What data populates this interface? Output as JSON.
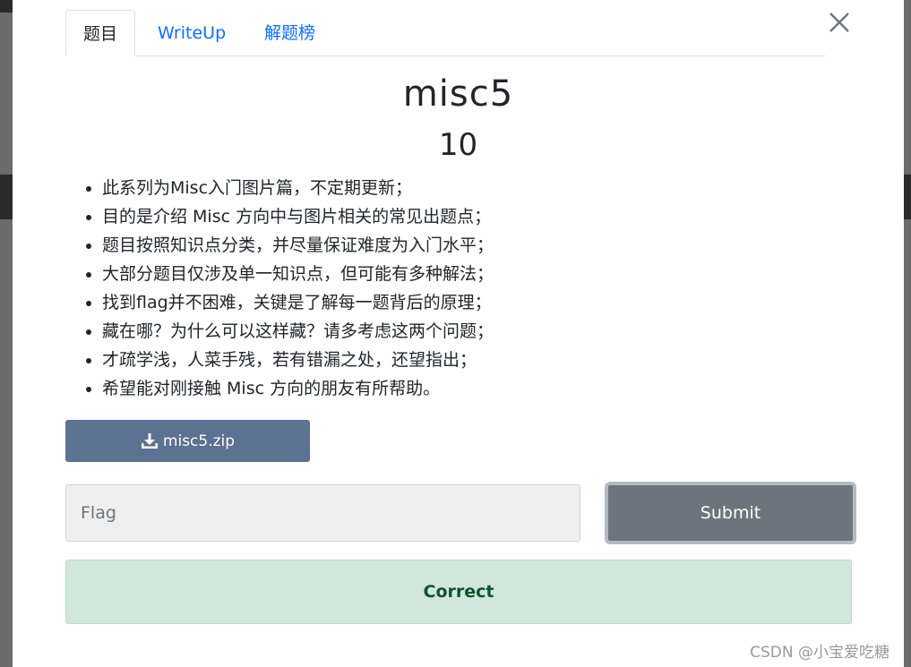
{
  "tabs": [
    {
      "label": "题目",
      "active": true
    },
    {
      "label": "WriteUp",
      "active": false
    },
    {
      "label": "解题榜",
      "active": false
    }
  ],
  "challenge": {
    "name": "misc5",
    "value": "10",
    "description": [
      "此系列为Misc入门图片篇，不定期更新；",
      "目的是介绍 Misc 方向中与图片相关的常见出题点；",
      "题目按照知识点分类，并尽量保证难度为入门水平；",
      "大部分题目仅涉及单一知识点，但可能有多种解法；",
      "找到flag并不困难，关键是了解每一题背后的原理；",
      "藏在哪？为什么可以这样藏？请多考虑这两个问题；",
      "才疏学浅，人菜手残，若有错漏之处，还望指出；",
      "希望能对刚接触 Misc 方向的朋友有所帮助。"
    ],
    "file_label": "misc5.zip"
  },
  "form": {
    "flag_placeholder": "Flag",
    "flag_value": "",
    "submit_label": "Submit"
  },
  "result": {
    "message": "Correct"
  },
  "watermark": "CSDN @小宝爱吃糖",
  "icons": {
    "close": "close-icon",
    "download": "download-icon"
  },
  "colors": {
    "tab_link": "#0d6efd",
    "download_button": "#5b7290",
    "submit_button": "#6c757d",
    "success_bg": "#d1e7dd",
    "success_text": "#0f5132"
  }
}
